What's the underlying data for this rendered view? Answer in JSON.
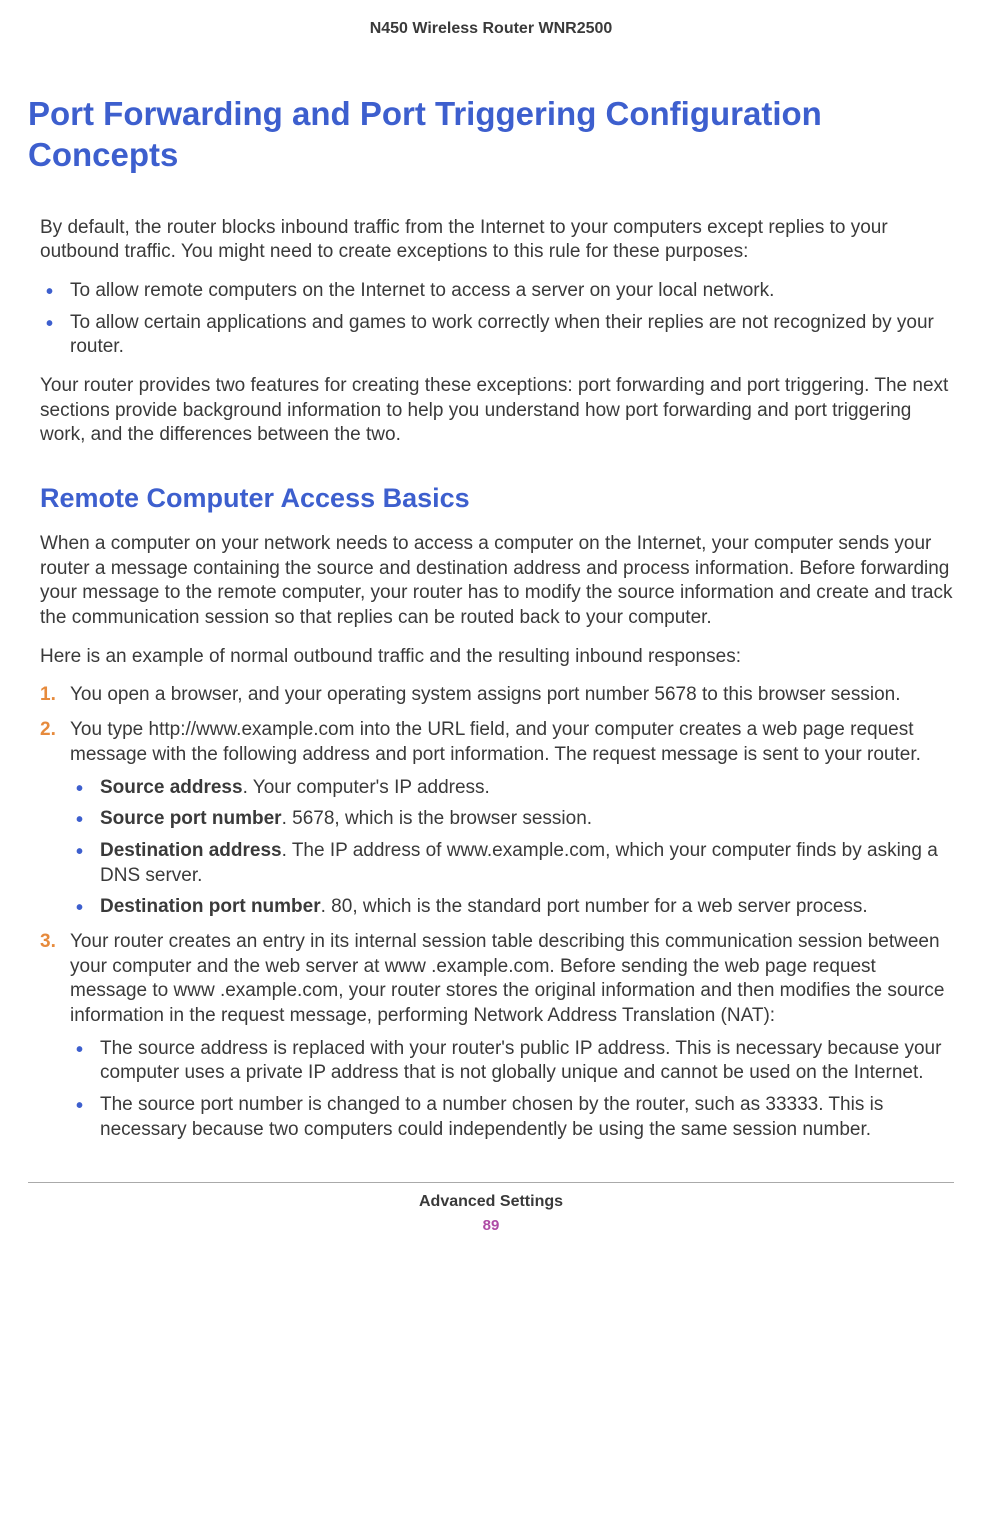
{
  "header": {
    "product": "N450 Wireless Router WNR2500"
  },
  "h1": "Port Forwarding and Port Triggering Configuration Concepts",
  "intro_p1": "By default, the router blocks inbound traffic from the Internet to your computers except replies to your outbound traffic. You might need to create exceptions to this rule for these purposes:",
  "intro_bullets": [
    "To allow remote computers on the Internet to access a server on your local network.",
    "To allow certain applications and games to work correctly when their replies are not recognized by your router."
  ],
  "intro_p2": "Your router provides two features for creating these exceptions: port forwarding and port triggering. The next sections provide background information to help you understand how port forwarding and port triggering work, and the differences between the two.",
  "h2": "Remote Computer Access Basics",
  "sec_p1": "When a computer on your network needs to access a computer on the Internet, your computer sends your router a message containing the source and destination address and process information. Before forwarding your message to the remote computer, your router has to modify the source information and create and track the communication session so that replies can be routed back to your computer.",
  "sec_p2": "Here is an example of normal outbound traffic and the resulting inbound responses:",
  "steps": {
    "s1": "You open a browser, and your operating system assigns port number 5678 to this browser session.",
    "s2": "You type http://www.example.com into the URL field, and your computer creates a web page request message with the following address and port information.   The request message is sent to your  router.",
    "s2_sub": {
      "a_label": "Source address",
      "a_text": ". Your computer's IP address.",
      "b_label": "Source port number",
      "b_text": ". 5678, which is the browser session.",
      "c_label": "Destination address",
      "c_text": ". The IP address of www.example.com, which your computer finds by asking a DNS server.",
      "d_label": "Destination port number",
      "d_text": ". 80, which is the standard port number for a web server process."
    },
    "s3": "Your router creates an entry in its internal session table describing this communication session between your computer and the web server at www .example.com. Before sending the web page request message to www .example.com, your  router  stores the original information and then modifies the source information in the request message, performing Network Address Translation (NAT):",
    "s3_sub": [
      "The source address is replaced with your router's public IP address. This is necessary because your computer uses a private IP address that is not globally unique and cannot be used on the Internet.",
      "The source port number is changed to a number chosen by the router, such as 33333. This is necessary because two computers could independently be using the same session number."
    ]
  },
  "footer": {
    "section": "Advanced Settings",
    "page": "89"
  }
}
